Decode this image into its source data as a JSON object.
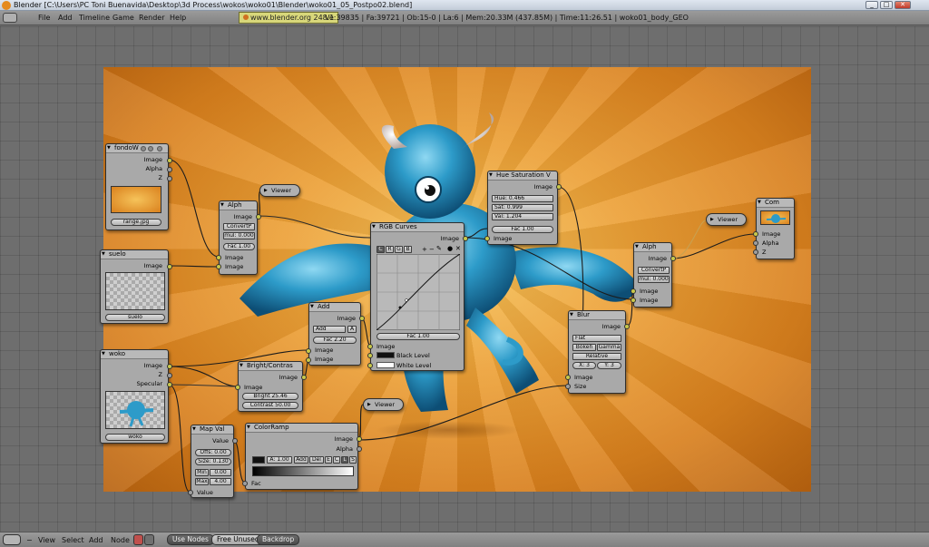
{
  "titlebar": {
    "title": "Blender [C:\\Users\\PC Toni Buenavida\\Desktop\\3d Process\\wokos\\woko01\\Blender\\woko01_05_Postpo02.blend]",
    "minimize": "_",
    "maximize": "□",
    "close": "✕"
  },
  "menu": {
    "items": [
      "File",
      "Add",
      "Timeline",
      "Game",
      "Render",
      "Help"
    ],
    "url": "www.blender.org 248.1",
    "stats": "Ve:39835 | Fa:39721 | Ob:15-0 | La:6 | Mem:20.33M (437.85M) | Time:11:26.51 | woko01_body_GEO"
  },
  "nodes": {
    "fondow": {
      "title": "fondoW",
      "out_image": "Image",
      "out_alpha": "Alpha",
      "out_z": "Z",
      "file": "range.jpg"
    },
    "alph1": {
      "title": "Alph",
      "out_image": "Image",
      "convert": "ConvertP",
      "mul": "mul: 0.000",
      "fac": "Fac 1.00",
      "in_image1": "Image",
      "in_image2": "Image"
    },
    "viewer1": {
      "title": "Viewer"
    },
    "suelo": {
      "title": "suelo",
      "out_image": "Image",
      "file": "suelo"
    },
    "add": {
      "title": "Add",
      "mode": "Add",
      "a": "A",
      "fac": "Fac 2.20",
      "out_image": "Image",
      "in_image1": "Image",
      "in_image2": "Image"
    },
    "woko": {
      "title": "woko",
      "out_image": "Image",
      "out_z": "Z",
      "out_specular": "Specular",
      "file": "woko"
    },
    "bright": {
      "title": "Bright/Contras",
      "out_image": "Image",
      "in_image": "Image",
      "bright": "Bright 25.46",
      "contrast": "Contrast 50.00"
    },
    "rgbcurves": {
      "title": "RGB Curves",
      "tabs": [
        "C",
        "R",
        "G",
        "B"
      ],
      "out_image": "Image",
      "fac": "Fac 1.00",
      "in_image": "Image",
      "black": "Black Level",
      "white": "White Level"
    },
    "huesat": {
      "title": "Hue Saturation V",
      "out_image": "Image",
      "hue": "Hue: 0.466",
      "sat": "Sat: 0.999",
      "val": "Val: 1.204",
      "fac": "Fac 1.00",
      "in_image": "Image"
    },
    "viewer2": {
      "title": "Viewer"
    },
    "viewer3": {
      "title": "Viewer"
    },
    "mapval": {
      "title": "Map Val",
      "out_value": "Value",
      "offs": "Offs: 0.00",
      "size": "Size: 0.130",
      "min_label": "Min",
      "min_val": "0.00",
      "max_label": "Max",
      "max_val": "4.00",
      "in_value": "Value"
    },
    "colorramp": {
      "title": "ColorRamp",
      "out_image": "Image",
      "out_alpha": "Alpha",
      "a": "A: 1.00",
      "add": "Add",
      "del": "Del",
      "e": "E",
      "c": "C",
      "l": "L",
      "s": "S",
      "in_fac": "Fac"
    },
    "blur": {
      "title": "Blur",
      "out_image": "Image",
      "type": "Flat",
      "bokeh": "Bokeh",
      "gamma": "Gamma",
      "relative": "Relative",
      "x": "X: 3",
      "y": "Y: 3",
      "in_image": "Image",
      "in_size": "Size"
    },
    "alph2": {
      "title": "Alph",
      "out_image": "Image",
      "convert": "ConvertP",
      "mul": "mul: 0.000",
      "in_image1": "Image",
      "in_image2": "Image"
    },
    "composite": {
      "title": "Com",
      "in_image": "Image",
      "in_alpha": "Alpha",
      "in_z": "Z"
    }
  },
  "bottom": {
    "items": [
      "View",
      "Select",
      "Add",
      "Node"
    ],
    "use_nodes": "Use Nodes",
    "free_unused": "Free Unused",
    "backdrop": "Backdrop"
  },
  "colors": {
    "socket_color": "#c9c94a",
    "socket_value": "#9e9e9e",
    "backdrop_orange": "#ecA036"
  }
}
